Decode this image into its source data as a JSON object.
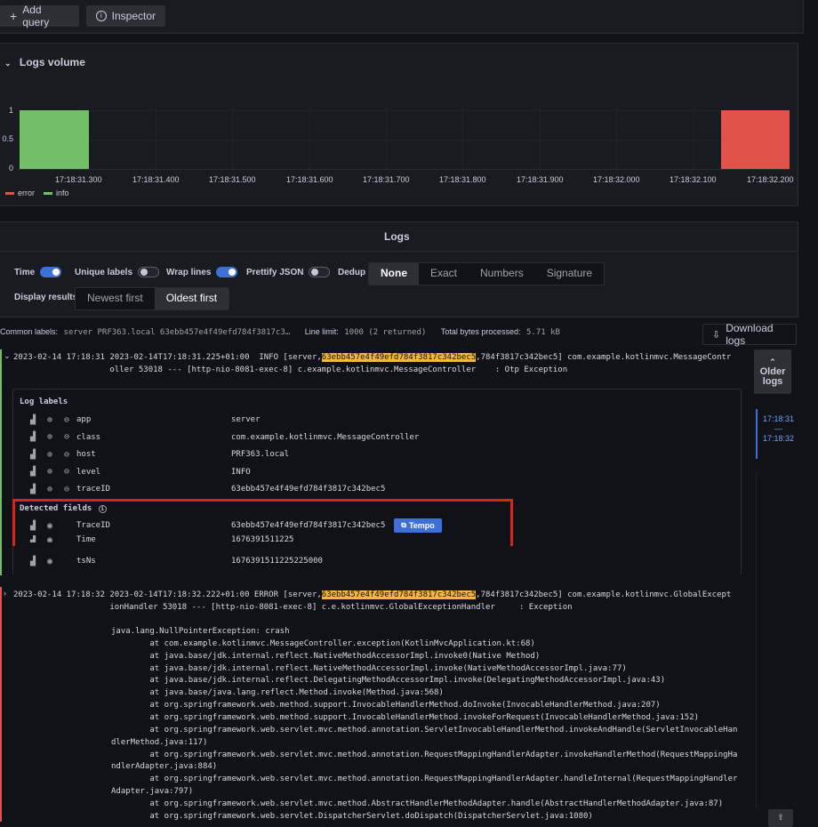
{
  "toolbar": {
    "add_query": "Add query",
    "inspector": "Inspector"
  },
  "logs_volume": {
    "title": "Logs volume",
    "y_ticks": [
      "1",
      "0.5",
      "0"
    ],
    "x_ticks": [
      "17:18:31.300",
      "17:18:31.400",
      "17:18:31.500",
      "17:18:31.600",
      "17:18:31.700",
      "17:18:31.800",
      "17:18:31.900",
      "17:18:32.000",
      "17:18:32.100",
      "17:18:32.200"
    ],
    "legend": [
      {
        "name": "error",
        "color": "#e0524a"
      },
      {
        "name": "info",
        "color": "#73bf69"
      }
    ]
  },
  "chart_data": {
    "type": "bar",
    "title": "Logs volume",
    "x": [
      "17:18:31.225",
      "17:18:32.222"
    ],
    "series": [
      {
        "name": "info",
        "values": [
          1,
          0
        ],
        "color": "#73bf69"
      },
      {
        "name": "error",
        "values": [
          0,
          1
        ],
        "color": "#e0524a"
      }
    ],
    "ylim": [
      0,
      1
    ]
  },
  "logs": {
    "title": "Logs",
    "controls": {
      "time": "Time",
      "unique_labels": "Unique labels",
      "wrap_lines": "Wrap lines",
      "prettify_json": "Prettify JSON",
      "dedup": "Dedup",
      "display_results": "Display results",
      "time_on": true,
      "unique_on": false,
      "wrap_on": true,
      "prettify_on": false
    },
    "dedup_options": [
      "None",
      "Exact",
      "Numbers",
      "Signature"
    ],
    "dedup_selected": "None",
    "order_options": [
      "Newest first",
      "Oldest first"
    ],
    "order_selected": "Oldest first",
    "meta": {
      "common_labels_key": "Common labels:",
      "common_labels_value": "server PRF363.local 63ebb457e4f49efd784f3817c3…",
      "line_limit_key": "Line limit:",
      "line_limit_value": "1000 (2 returned)",
      "bytes_key": "Total bytes processed:",
      "bytes_value": "5.71 kB"
    },
    "download": "Download logs",
    "older_logs": "Older logs",
    "nav_start": "17:18:31",
    "nav_dash": "—",
    "nav_end": "17:18:32",
    "entry1": {
      "pre": "2023-02-14 17:18:31 2023-02-14T17:18:31.225+01:00  INFO [server,",
      "hl": "63ebb457e4f49efd784f3817c342bec5",
      "post": ",784f3817c342bec5] com.example.kotlinmvc.MessageContr",
      "line2": "                    oller 53018 --- [http-nio-8081-exec-8] c.example.kotlinmvc.MessageController    : Otp Exception"
    },
    "log_labels_title": "Log labels",
    "labels": [
      {
        "key": "app",
        "value": "server"
      },
      {
        "key": "class",
        "value": "com.example.kotlinmvc.MessageController"
      },
      {
        "key": "host",
        "value": "PRF363.local"
      },
      {
        "key": "level",
        "value": "INFO"
      },
      {
        "key": "traceID",
        "value": "63ebb457e4f49efd784f3817c342bec5"
      }
    ],
    "detected_fields_title": "Detected fields",
    "fields": [
      {
        "key": "TraceID",
        "value": "63ebb457e4f49efd784f3817c342bec5"
      },
      {
        "key": "Time",
        "value": "1676391511225"
      },
      {
        "key": "tsNs",
        "value": "1676391511225225000"
      }
    ],
    "tempo_label": "Tempo",
    "entry2": {
      "pre": "2023-02-14 17:18:32 2023-02-14T17:18:32.222+01:00 ERROR [server,",
      "hl": "63ebb457e4f49efd784f3817c342bec5",
      "post": ",784f3817c342bec5] com.example.kotlinmvc.GlobalExcept",
      "line2": "                    ionHandler 53018 --- [http-nio-8081-exec-8] c.e.kotlinmvc.GlobalExceptionHandler     : Exception"
    },
    "stacktrace": [
      "java.lang.NullPointerException: crash",
      "        at com.example.kotlinmvc.MessageController.exception(KotlinMvcApplication.kt:68)",
      "        at java.base/jdk.internal.reflect.NativeMethodAccessorImpl.invoke0(Native Method)",
      "        at java.base/jdk.internal.reflect.NativeMethodAccessorImpl.invoke(NativeMethodAccessorImpl.java:77)",
      "        at java.base/jdk.internal.reflect.DelegatingMethodAccessorImpl.invoke(DelegatingMethodAccessorImpl.java:43)",
      "        at java.base/java.lang.reflect.Method.invoke(Method.java:568)",
      "        at org.springframework.web.method.support.InvocableHandlerMethod.doInvoke(InvocableHandlerMethod.java:207)",
      "        at org.springframework.web.method.support.InvocableHandlerMethod.invokeForRequest(InvocableHandlerMethod.java:152)",
      "        at org.springframework.web.servlet.mvc.method.annotation.ServletInvocableHandlerMethod.invokeAndHandle(ServletInvocableHan",
      "dlerMethod.java:117)",
      "        at org.springframework.web.servlet.mvc.method.annotation.RequestMappingHandlerAdapter.invokeHandlerMethod(RequestMappingHa",
      "ndlerAdapter.java:884)",
      "        at org.springframework.web.servlet.mvc.method.annotation.RequestMappingHandlerAdapter.handleInternal(RequestMappingHandler",
      "Adapter.java:797)",
      "        at org.springframework.web.servlet.mvc.method.AbstractHandlerMethodAdapter.handle(AbstractHandlerMethodAdapter.java:87)",
      "        at org.springframework.web.servlet.DispatcherServlet.doDispatch(DispatcherServlet.java:1080)"
    ]
  }
}
